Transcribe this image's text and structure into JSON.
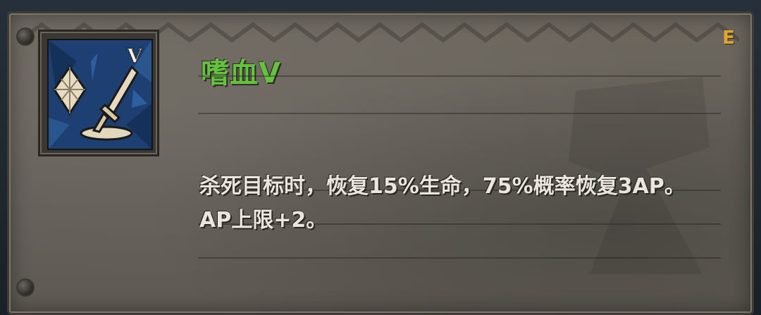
{
  "skill": {
    "name": "嗜血V",
    "rank_roman": "V",
    "corner_key": "E",
    "description": "杀死目标时，恢复15%生命，75%概率恢复3AP。AP上限+2。",
    "icon": "crystal-and-sword-icon"
  },
  "colors": {
    "title_green": "#64c23f",
    "corner_key_orange": "#e2a52e",
    "icon_blue": "#1e3f72",
    "icon_gem": "#e8dcc0"
  }
}
